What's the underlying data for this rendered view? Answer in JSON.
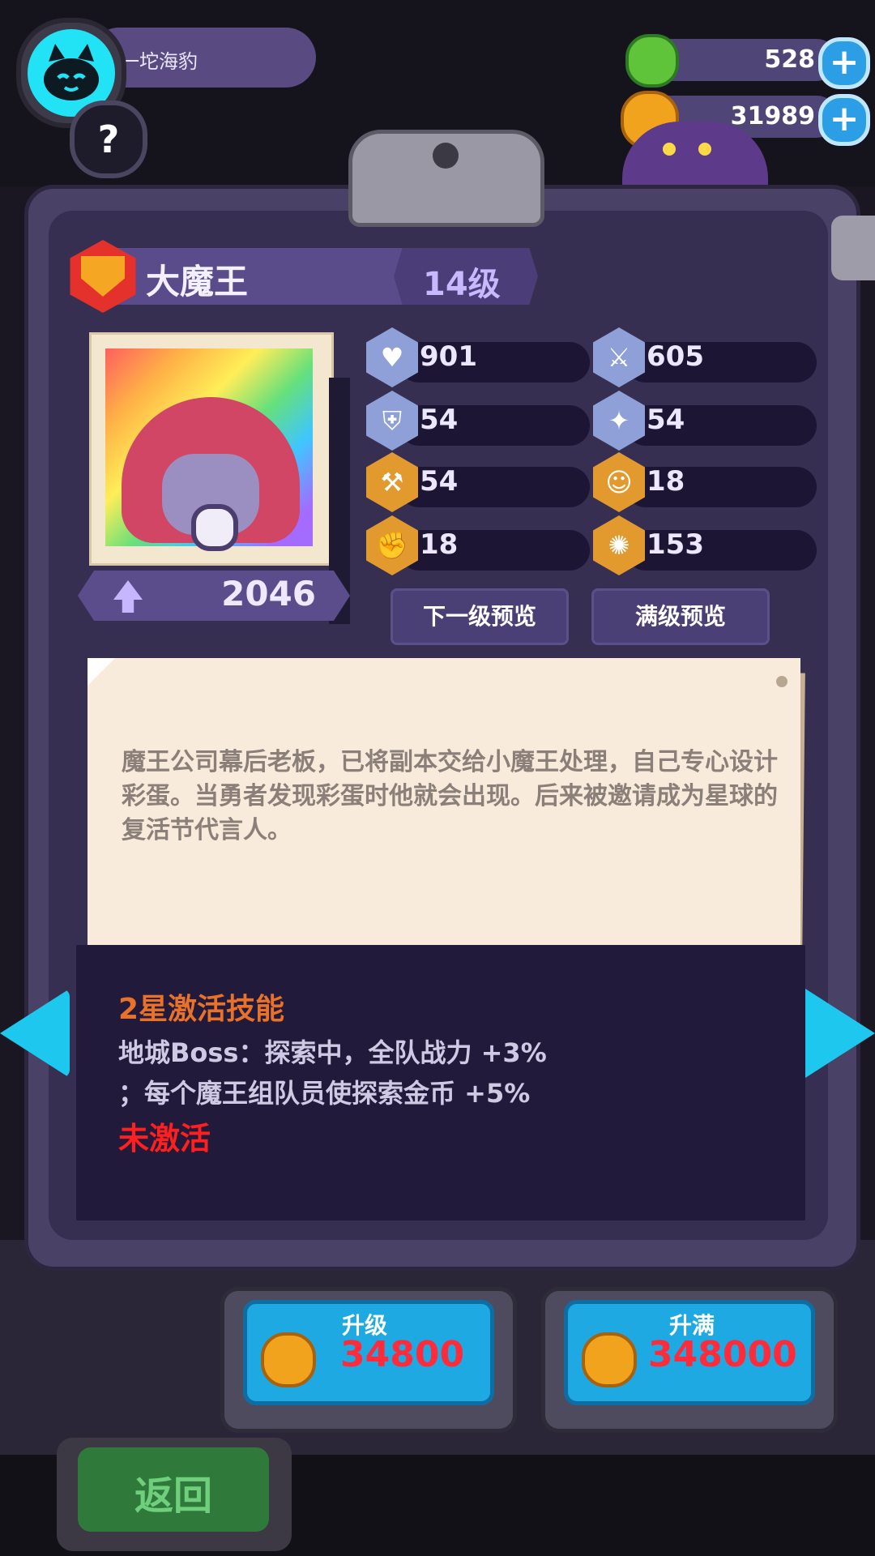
{
  "player": {
    "name": "一坨海豹",
    "help_label": "?"
  },
  "currencies": [
    {
      "name": "gem",
      "value": "528",
      "add_label": "+"
    },
    {
      "name": "coin",
      "value": "31989",
      "add_label": "+"
    }
  ],
  "character": {
    "name": "大魔王",
    "level": "14级",
    "power": "2046",
    "description": "魔王公司幕后老板，已将副本交给小魔王处理，自己专心设计彩蛋。当勇者发现彩蛋时他就会出现。后来被邀请成为星球的复活节代言人。"
  },
  "stats": [
    {
      "icon": "heart-icon",
      "glyph": "♥",
      "value": "901"
    },
    {
      "icon": "sword-icon",
      "glyph": "⚔",
      "value": "605"
    },
    {
      "icon": "shield-icon",
      "glyph": "⛨",
      "value": "54"
    },
    {
      "icon": "magic-sword-icon",
      "glyph": "✦",
      "value": "54"
    },
    {
      "icon": "hammer-icon",
      "glyph": "⚒",
      "value": "54"
    },
    {
      "icon": "smile-icon",
      "glyph": "☺",
      "value": "18"
    },
    {
      "icon": "muscle-icon",
      "glyph": "✊",
      "value": "18"
    },
    {
      "icon": "brain-icon",
      "glyph": "✺",
      "value": "153"
    }
  ],
  "buttons": {
    "next_level_preview": "下一级预览",
    "max_level_preview": "满级预览",
    "upgrade_label": "升级",
    "upgrade_cost": "34800",
    "max_upgrade_label": "升满",
    "max_upgrade_cost": "348000",
    "back_label": "返回"
  },
  "skill": {
    "title": "2星激活技能",
    "description": "地城Boss：探索中，全队战力 +3%\n；每个魔王组队员使探索金币 +5%",
    "status": "未激活"
  },
  "colors": {
    "panel": "#4a4166",
    "accent_cyan": "#1ec7ee",
    "skill_title": "#e8722a",
    "inactive": "#ff1f1f",
    "price": "#ff2a3a"
  }
}
